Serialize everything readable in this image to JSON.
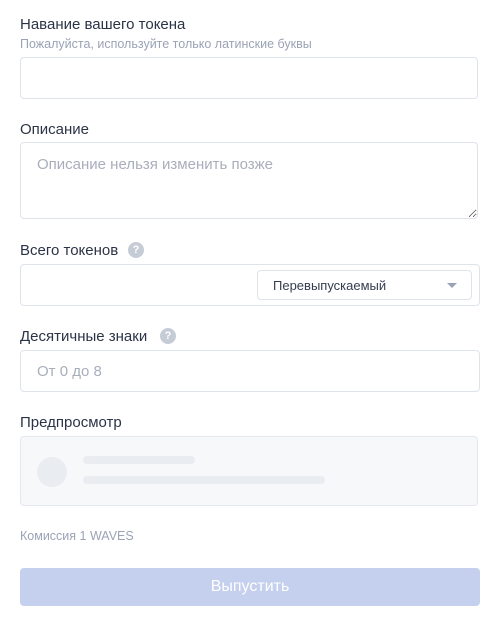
{
  "form": {
    "token_name": {
      "label": "Навание вашего токена",
      "hint": "Пожалуйста, используйте только латинские буквы",
      "value": "",
      "placeholder": ""
    },
    "description": {
      "label": "Описание",
      "value": "",
      "placeholder": "Описание нельзя изменить позже"
    },
    "total_tokens": {
      "label": "Всего токенов",
      "help_icon": "?",
      "value": "",
      "placeholder": "",
      "reissuable_select": {
        "selected": "Перевыпускаемый"
      }
    },
    "decimals": {
      "label": "Десятичные знаки",
      "help_icon": "?",
      "value": "",
      "placeholder": "От 0 до 8"
    },
    "preview": {
      "label": "Предпросмотр"
    },
    "fee_text": "Комиссия 1 WAVES",
    "submit_label": "Выпустить"
  },
  "colors": {
    "submit_disabled": "#c5cfee",
    "field_border": "#dfe3ea",
    "hint_text": "#9aa3b5",
    "label_text": "#2b3446"
  },
  "icons": {
    "help": "question-mark-circle-icon",
    "select": "chevron-down-icon"
  }
}
